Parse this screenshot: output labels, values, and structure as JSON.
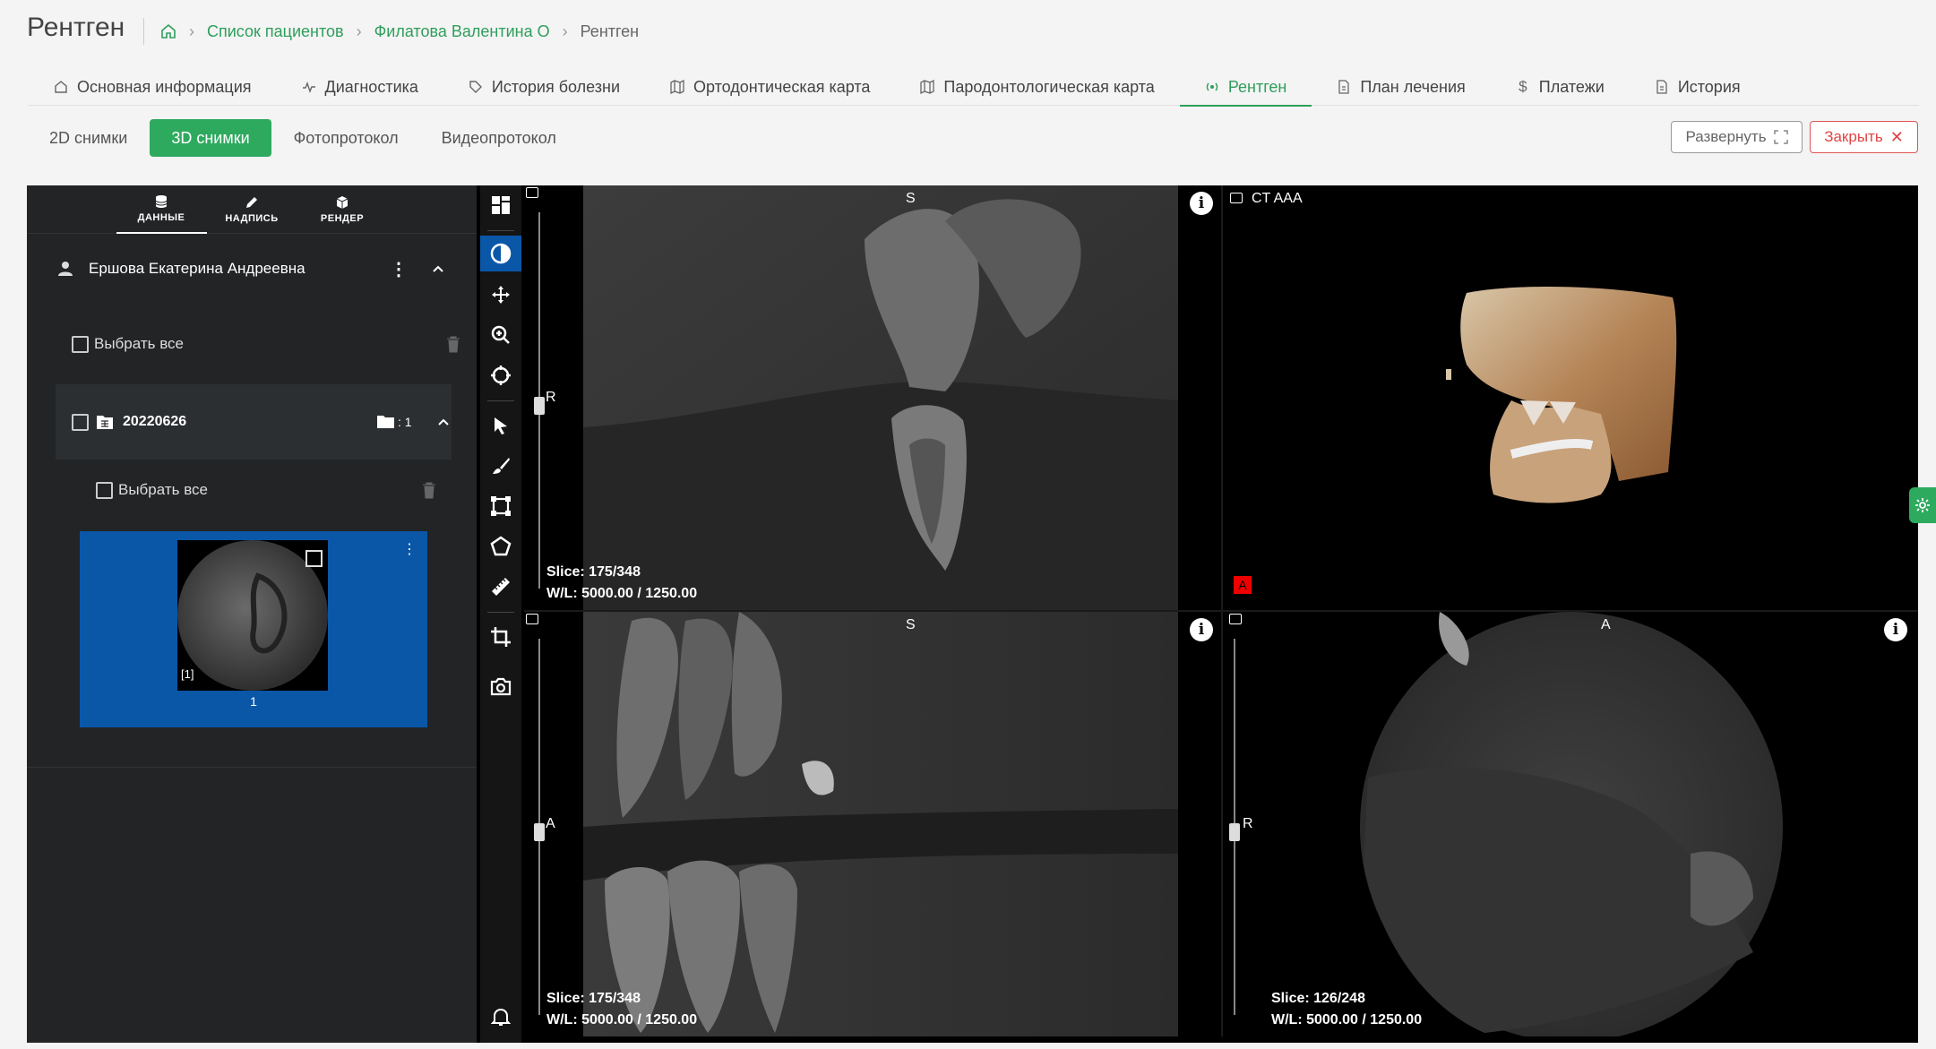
{
  "header": {
    "title": "Рентген",
    "breadcrumb": [
      "Список пациентов",
      "Филатова Валентина О",
      "Рентген"
    ]
  },
  "tabs": [
    {
      "label": "Основная информация",
      "icon": "home-icon"
    },
    {
      "label": "Диагностика",
      "icon": "pulse-icon"
    },
    {
      "label": "История болезни",
      "icon": "tag-icon"
    },
    {
      "label": "Ортодонтическая карта",
      "icon": "map-icon"
    },
    {
      "label": "Пародонтологическая карта",
      "icon": "map-icon"
    },
    {
      "label": "Рентген",
      "icon": "xray-icon",
      "active": true
    },
    {
      "label": "План лечения",
      "icon": "document-icon"
    },
    {
      "label": "Платежи",
      "icon": "dollar-icon"
    },
    {
      "label": "История",
      "icon": "document-icon"
    }
  ],
  "subtabs": [
    "2D снимки",
    "3D снимки",
    "Фотопротокол",
    "Видеопротокол"
  ],
  "actions": {
    "expand": "Развернуть",
    "close": "Закрыть"
  },
  "panel": {
    "tabs": [
      "ДАННЫЕ",
      "НАДПИСЬ",
      "РЕНДЕР"
    ],
    "patient": "Ершова Екатерина Андреевна",
    "select_all": "Выбрать все",
    "folder": {
      "name": "20220626",
      "count": ": 1"
    },
    "select_all_inner": "Выбрать все",
    "thumb": {
      "index_label": "[1]",
      "caption": "1"
    }
  },
  "viewports": {
    "top_left": {
      "top": "S",
      "left": "R",
      "slice": "Slice: 175/348",
      "wl": "W/L: 5000.00 / 1250.00"
    },
    "top_right": {
      "title": "CT AAA",
      "marker": "A"
    },
    "bottom_left": {
      "top": "S",
      "left": "A",
      "slice": "Slice: 175/348",
      "wl": "W/L: 5000.00 / 1250.00"
    },
    "bottom_right": {
      "top": "A",
      "left": "R",
      "slice": "Slice: 126/248",
      "wl": "W/L: 5000.00 / 1250.00"
    }
  },
  "colors": {
    "accent": "#2eaa5f",
    "selected": "#0a57a8",
    "danger": "#e04444"
  }
}
